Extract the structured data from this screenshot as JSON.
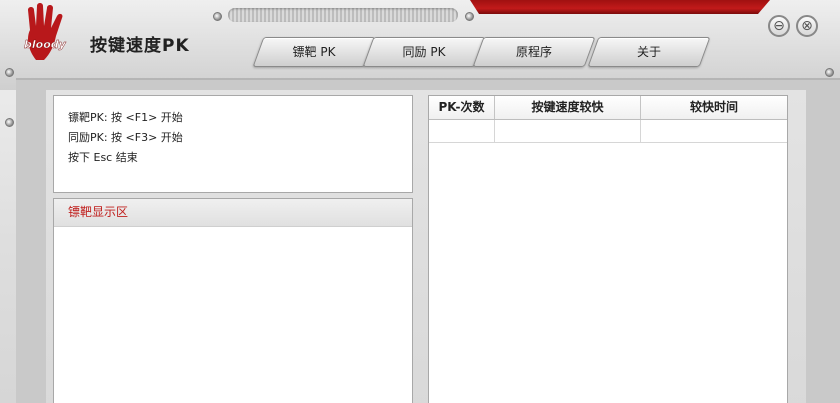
{
  "app": {
    "title": "按键速度PK",
    "logo_text": "bloody"
  },
  "window_controls": {
    "minimize": "⊖",
    "close": "⊗"
  },
  "tabs": [
    {
      "label": "镖靶 PK"
    },
    {
      "label": "同励 PK"
    },
    {
      "label": "原程序"
    },
    {
      "label": "关于"
    }
  ],
  "info": {
    "line1": "镖靶PK: 按 <F1> 开始",
    "line2": "同励PK: 按 <F3> 开始",
    "line3": "按下 Esc 结束"
  },
  "target_panel": {
    "title": "镖靶显示区"
  },
  "table": {
    "columns": [
      "PK-次数",
      "按键速度较快",
      "较快时间"
    ],
    "rows": [
      [
        "",
        "",
        ""
      ]
    ]
  },
  "colors": {
    "accent_red": "#c0201e",
    "chrome": "#d6d6d6"
  }
}
